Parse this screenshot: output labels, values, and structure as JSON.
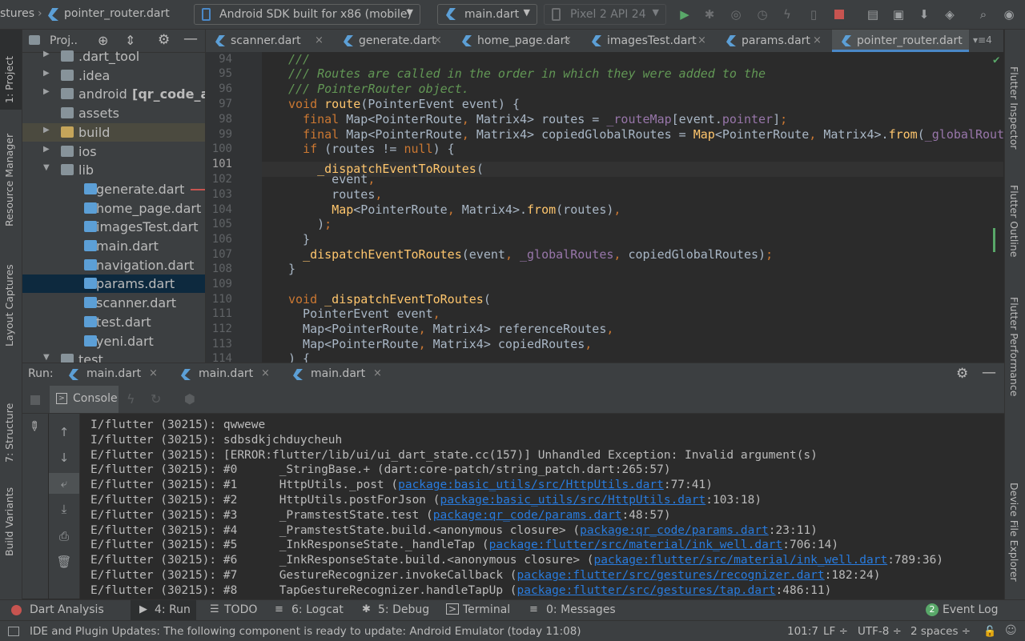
{
  "toolbar": {
    "breadcrumb_1": "stures",
    "breadcrumb_2": "pointer_router.dart",
    "device": "Android SDK built for x86 (mobile)",
    "run_config": "main.dart",
    "avd": "Pixel 2 API 24"
  },
  "project": {
    "title": "Proj..",
    "tree": [
      {
        "label": ".dart_tool",
        "indent": 0,
        "arrow": "▶",
        "icon": "folder"
      },
      {
        "label": ".idea",
        "indent": 0,
        "arrow": "▶",
        "icon": "folder"
      },
      {
        "label": "android",
        "suffix": "[qr_code_ar",
        "indent": 0,
        "arrow": "▶",
        "icon": "folder"
      },
      {
        "label": "assets",
        "indent": 0,
        "arrow": "",
        "icon": "folder"
      },
      {
        "label": "build",
        "indent": 0,
        "arrow": "▶",
        "icon": "folder-y"
      },
      {
        "label": "ios",
        "indent": 0,
        "arrow": "▶",
        "icon": "folder"
      },
      {
        "label": "lib",
        "indent": 0,
        "arrow": "▼",
        "icon": "folder"
      },
      {
        "label": "generate.dart",
        "indent": 1,
        "arrow": "",
        "icon": "dart"
      },
      {
        "label": "home_page.dart",
        "indent": 1,
        "arrow": "",
        "icon": "dart"
      },
      {
        "label": "imagesTest.dart",
        "indent": 1,
        "arrow": "",
        "icon": "dart"
      },
      {
        "label": "main.dart",
        "indent": 1,
        "arrow": "",
        "icon": "dart"
      },
      {
        "label": "navigation.dart",
        "indent": 1,
        "arrow": "",
        "icon": "dart"
      },
      {
        "label": "params.dart",
        "indent": 1,
        "arrow": "",
        "icon": "dart",
        "selected": true
      },
      {
        "label": "scanner.dart",
        "indent": 1,
        "arrow": "",
        "icon": "dart"
      },
      {
        "label": "test.dart",
        "indent": 1,
        "arrow": "",
        "icon": "dart"
      },
      {
        "label": "yeni.dart",
        "indent": 1,
        "arrow": "",
        "icon": "dart"
      },
      {
        "label": "test",
        "indent": 0,
        "arrow": "▼",
        "icon": "folder"
      }
    ]
  },
  "left_tabs": {
    "project": "1: Project",
    "resource": "Resource Manager",
    "layout": "Layout Captures",
    "structure": "7: Structure",
    "build": "Build Variants"
  },
  "right_tabs": {
    "inspector": "Flutter Inspector",
    "outline": "Flutter Outline",
    "performance": "Flutter Performance",
    "device": "Device File Explorer"
  },
  "editor_tabs": [
    "scanner.dart",
    "generate.dart",
    "home_page.dart",
    "imagesTest.dart",
    "params.dart",
    "pointer_router.dart"
  ],
  "editor_tab_overflow": "4",
  "editor": {
    "line_numbers": [
      "94",
      "95",
      "96",
      "97",
      "98",
      "99",
      "100",
      "101",
      "102",
      "103",
      "104",
      "105",
      "106",
      "107",
      "108",
      "109",
      "110",
      "111",
      "112",
      "113",
      "114"
    ]
  },
  "run": {
    "label": "Run:",
    "tabs": [
      "main.dart",
      "main.dart",
      "main.dart"
    ],
    "console_tab": "Console",
    "console_lines": [
      {
        "text": "I/flutter (30215): qwwewe"
      },
      {
        "text": "I/flutter (30215): sdbsdkjchduycheuh"
      },
      {
        "text": "E/flutter (30215): [ERROR:flutter/lib/ui/ui_dart_state.cc(157)] Unhandled Exception: Invalid argument(s)"
      },
      {
        "text": "E/flutter (30215): #0      _StringBase.+ (dart:core-patch/string_patch.dart:265:57)"
      },
      {
        "pre": "E/flutter (30215): #1      HttpUtils._post (",
        "link": "package:basic_utils/src/HttpUtils.dart",
        "post": ":77:41)"
      },
      {
        "pre": "E/flutter (30215): #2      HttpUtils.postForJson (",
        "link": "package:basic_utils/src/HttpUtils.dart",
        "post": ":103:18)"
      },
      {
        "pre": "E/flutter (30215): #3      _PramstestState.test (",
        "link": "package:qr_code/params.dart",
        "post": ":48:57)"
      },
      {
        "pre": "E/flutter (30215): #4      _PramstestState.build.<anonymous closure> (",
        "link": "package:qr_code/params.dart",
        "post": ":23:11)"
      },
      {
        "pre": "E/flutter (30215): #5      _InkResponseState._handleTap (",
        "link": "package:flutter/src/material/ink_well.dart",
        "post": ":706:14)"
      },
      {
        "pre": "E/flutter (30215): #6      _InkResponseState.build.<anonymous closure> (",
        "link": "package:flutter/src/material/ink_well.dart",
        "post": ":789:36)"
      },
      {
        "pre": "E/flutter (30215): #7      GestureRecognizer.invokeCallback (",
        "link": "package:flutter/src/gestures/recognizer.dart",
        "post": ":182:24)"
      },
      {
        "pre": "E/flutter (30215): #8      TapGestureRecognizer.handleTapUp (",
        "link": "package:flutter/src/gestures/tap.dart",
        "post": ":486:11)"
      }
    ]
  },
  "bottom_bar": {
    "dart_analysis": "Dart Analysis",
    "run": "4: Run",
    "todo": "TODO",
    "logcat": "6: Logcat",
    "debug": "5: Debug",
    "terminal": "Terminal",
    "messages": "0: Messages",
    "event_log_count": "2",
    "event_log": "Event Log"
  },
  "status": {
    "message": "IDE and Plugin Updates: The following component is ready to update: Android Emulator (today 11:08)",
    "position": "101:7",
    "line_sep": "LF ÷",
    "encoding": "UTF-8 ÷",
    "indent": "2 spaces ÷"
  }
}
